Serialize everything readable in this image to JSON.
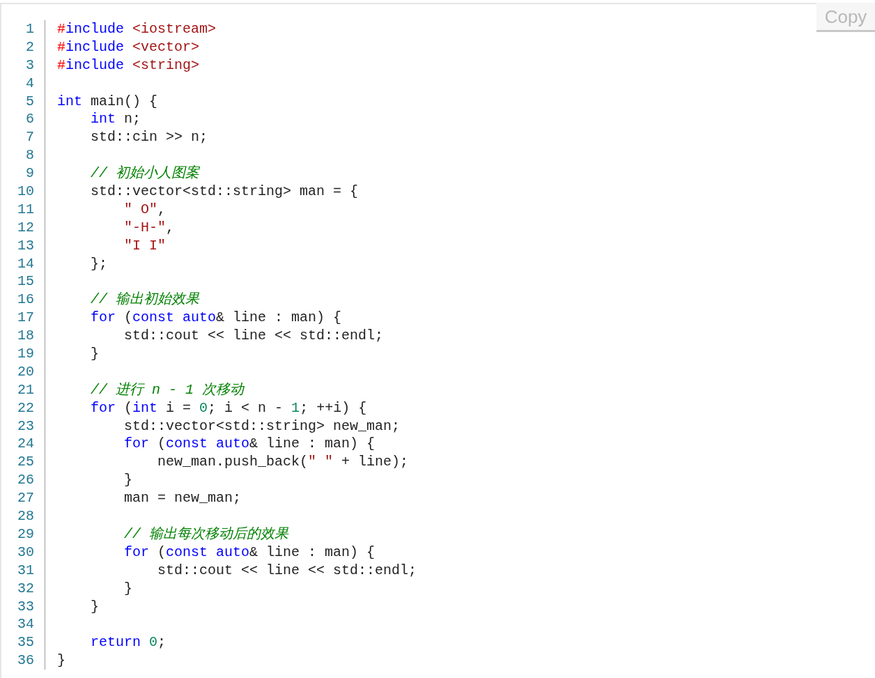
{
  "copy_button": {
    "label": "Copy"
  },
  "code": {
    "lines": [
      {
        "number": "1",
        "tokens": [
          {
            "kind": "hash",
            "text": "#"
          },
          {
            "kind": "keyword",
            "text": "include"
          },
          {
            "kind": "string",
            "text": " <iostream>"
          }
        ]
      },
      {
        "number": "2",
        "tokens": [
          {
            "kind": "hash",
            "text": "#"
          },
          {
            "kind": "keyword",
            "text": "include"
          },
          {
            "kind": "string",
            "text": " <vector>"
          }
        ]
      },
      {
        "number": "3",
        "tokens": [
          {
            "kind": "hash",
            "text": "#"
          },
          {
            "kind": "keyword",
            "text": "include"
          },
          {
            "kind": "string",
            "text": " <string>"
          }
        ]
      },
      {
        "number": "4"
      },
      {
        "number": "5",
        "tokens": [
          {
            "kind": "keyword",
            "text": "int"
          },
          {
            "kind": "plain",
            "text": " main() {"
          }
        ]
      },
      {
        "number": "6",
        "tokens": [
          {
            "kind": "keyword",
            "text": "    int"
          },
          {
            "kind": "plain",
            "text": " n;"
          }
        ]
      },
      {
        "number": "7",
        "tokens": [
          {
            "kind": "plain",
            "text": "    std::cin >> n;"
          }
        ]
      },
      {
        "number": "8"
      },
      {
        "number": "9",
        "tokens": [
          {
            "kind": "comment",
            "text": "    // 初始小人图案"
          }
        ]
      },
      {
        "number": "10",
        "tokens": [
          {
            "kind": "plain",
            "text": "    std::vector<std::string> man = {"
          }
        ]
      },
      {
        "number": "11",
        "tokens": [
          {
            "kind": "string",
            "text": "        \" O\""
          },
          {
            "kind": "plain",
            "text": ","
          }
        ]
      },
      {
        "number": "12",
        "tokens": [
          {
            "kind": "string",
            "text": "        \"-H-\""
          },
          {
            "kind": "plain",
            "text": ","
          }
        ]
      },
      {
        "number": "13",
        "tokens": [
          {
            "kind": "string",
            "text": "        \"I I\""
          }
        ]
      },
      {
        "number": "14",
        "tokens": [
          {
            "kind": "plain",
            "text": "    };"
          }
        ]
      },
      {
        "number": "15"
      },
      {
        "number": "16",
        "tokens": [
          {
            "kind": "comment",
            "text": "    // 输出初始效果"
          }
        ]
      },
      {
        "number": "17",
        "tokens": [
          {
            "kind": "keyword",
            "text": "    for"
          },
          {
            "kind": "plain",
            "text": " ("
          },
          {
            "kind": "keyword",
            "text": "const auto"
          },
          {
            "kind": "plain",
            "text": "& line : man) {"
          }
        ]
      },
      {
        "number": "18",
        "tokens": [
          {
            "kind": "plain",
            "text": "        std::cout << line << std::endl;"
          }
        ]
      },
      {
        "number": "19",
        "tokens": [
          {
            "kind": "plain",
            "text": "    }"
          }
        ]
      },
      {
        "number": "20"
      },
      {
        "number": "21",
        "tokens": [
          {
            "kind": "comment",
            "text": "    // 进行 n - 1 次移动"
          }
        ]
      },
      {
        "number": "22",
        "tokens": [
          {
            "kind": "keyword",
            "text": "    for"
          },
          {
            "kind": "plain",
            "text": " ("
          },
          {
            "kind": "keyword",
            "text": "int"
          },
          {
            "kind": "plain",
            "text": " i = "
          },
          {
            "kind": "number",
            "text": "0"
          },
          {
            "kind": "plain",
            "text": "; i < n - "
          },
          {
            "kind": "number",
            "text": "1"
          },
          {
            "kind": "plain",
            "text": "; ++i) {"
          }
        ]
      },
      {
        "number": "23",
        "tokens": [
          {
            "kind": "plain",
            "text": "        std::vector<std::string> new_man;"
          }
        ]
      },
      {
        "number": "24",
        "tokens": [
          {
            "kind": "keyword",
            "text": "        for"
          },
          {
            "kind": "plain",
            "text": " ("
          },
          {
            "kind": "keyword",
            "text": "const auto"
          },
          {
            "kind": "plain",
            "text": "& line : man) {"
          }
        ]
      },
      {
        "number": "25",
        "tokens": [
          {
            "kind": "plain",
            "text": "            new_man.push_back("
          },
          {
            "kind": "string",
            "text": "\" \""
          },
          {
            "kind": "plain",
            "text": " + line);"
          }
        ]
      },
      {
        "number": "26",
        "tokens": [
          {
            "kind": "plain",
            "text": "        }"
          }
        ]
      },
      {
        "number": "27",
        "tokens": [
          {
            "kind": "plain",
            "text": "        man = new_man;"
          }
        ]
      },
      {
        "number": "28"
      },
      {
        "number": "29",
        "tokens": [
          {
            "kind": "comment",
            "text": "        // 输出每次移动后的效果"
          }
        ]
      },
      {
        "number": "30",
        "tokens": [
          {
            "kind": "keyword",
            "text": "        for"
          },
          {
            "kind": "plain",
            "text": " ("
          },
          {
            "kind": "keyword",
            "text": "const auto"
          },
          {
            "kind": "plain",
            "text": "& line : man) {"
          }
        ]
      },
      {
        "number": "31",
        "tokens": [
          {
            "kind": "plain",
            "text": "            std::cout << line << std::endl;"
          }
        ]
      },
      {
        "number": "32",
        "tokens": [
          {
            "kind": "plain",
            "text": "        }"
          }
        ]
      },
      {
        "number": "33",
        "tokens": [
          {
            "kind": "plain",
            "text": "    }"
          }
        ]
      },
      {
        "number": "34"
      },
      {
        "number": "35",
        "tokens": [
          {
            "kind": "keyword",
            "text": "    return"
          },
          {
            "kind": "number",
            "text": " 0"
          },
          {
            "kind": "plain",
            "text": ";"
          }
        ]
      },
      {
        "number": "36",
        "tokens": [
          {
            "kind": "plain",
            "text": "}"
          }
        ]
      }
    ]
  }
}
